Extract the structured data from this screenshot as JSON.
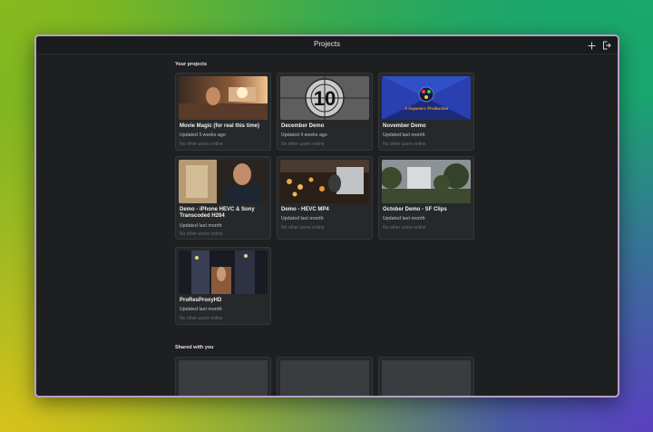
{
  "window": {
    "title": "Projects"
  },
  "toolbar": {
    "add_icon": "plus-icon",
    "exit_icon": "sign-out-icon"
  },
  "sections": {
    "your_projects": "Your projects",
    "shared": "Shared with you"
  },
  "projects": [
    {
      "title": "Movie Magic (for real this time)",
      "updated": "Updated 3 weeks ago",
      "online": "No other users online"
    },
    {
      "title": "December Demo",
      "updated": "Updated 4 weeks ago",
      "online": "No other users online"
    },
    {
      "title": "November Demo",
      "updated": "Updated last month",
      "online": "No other users online"
    },
    {
      "title": "Demo - iPhone HEVC & Sony Transcoded H264",
      "updated": "Updated last month",
      "online": "No other users online"
    },
    {
      "title": "Demo - HEVC MP4",
      "updated": "Updated last month",
      "online": "No other users online"
    },
    {
      "title": "October Demo - SF Clips",
      "updated": "Updated last month",
      "online": "No other users online"
    },
    {
      "title": "ProResProxyHD",
      "updated": "Updated last month",
      "online": "No other users online"
    }
  ],
  "thumbnails": {
    "countdown_number": "10",
    "sequence_title": "A Sequence Production"
  }
}
